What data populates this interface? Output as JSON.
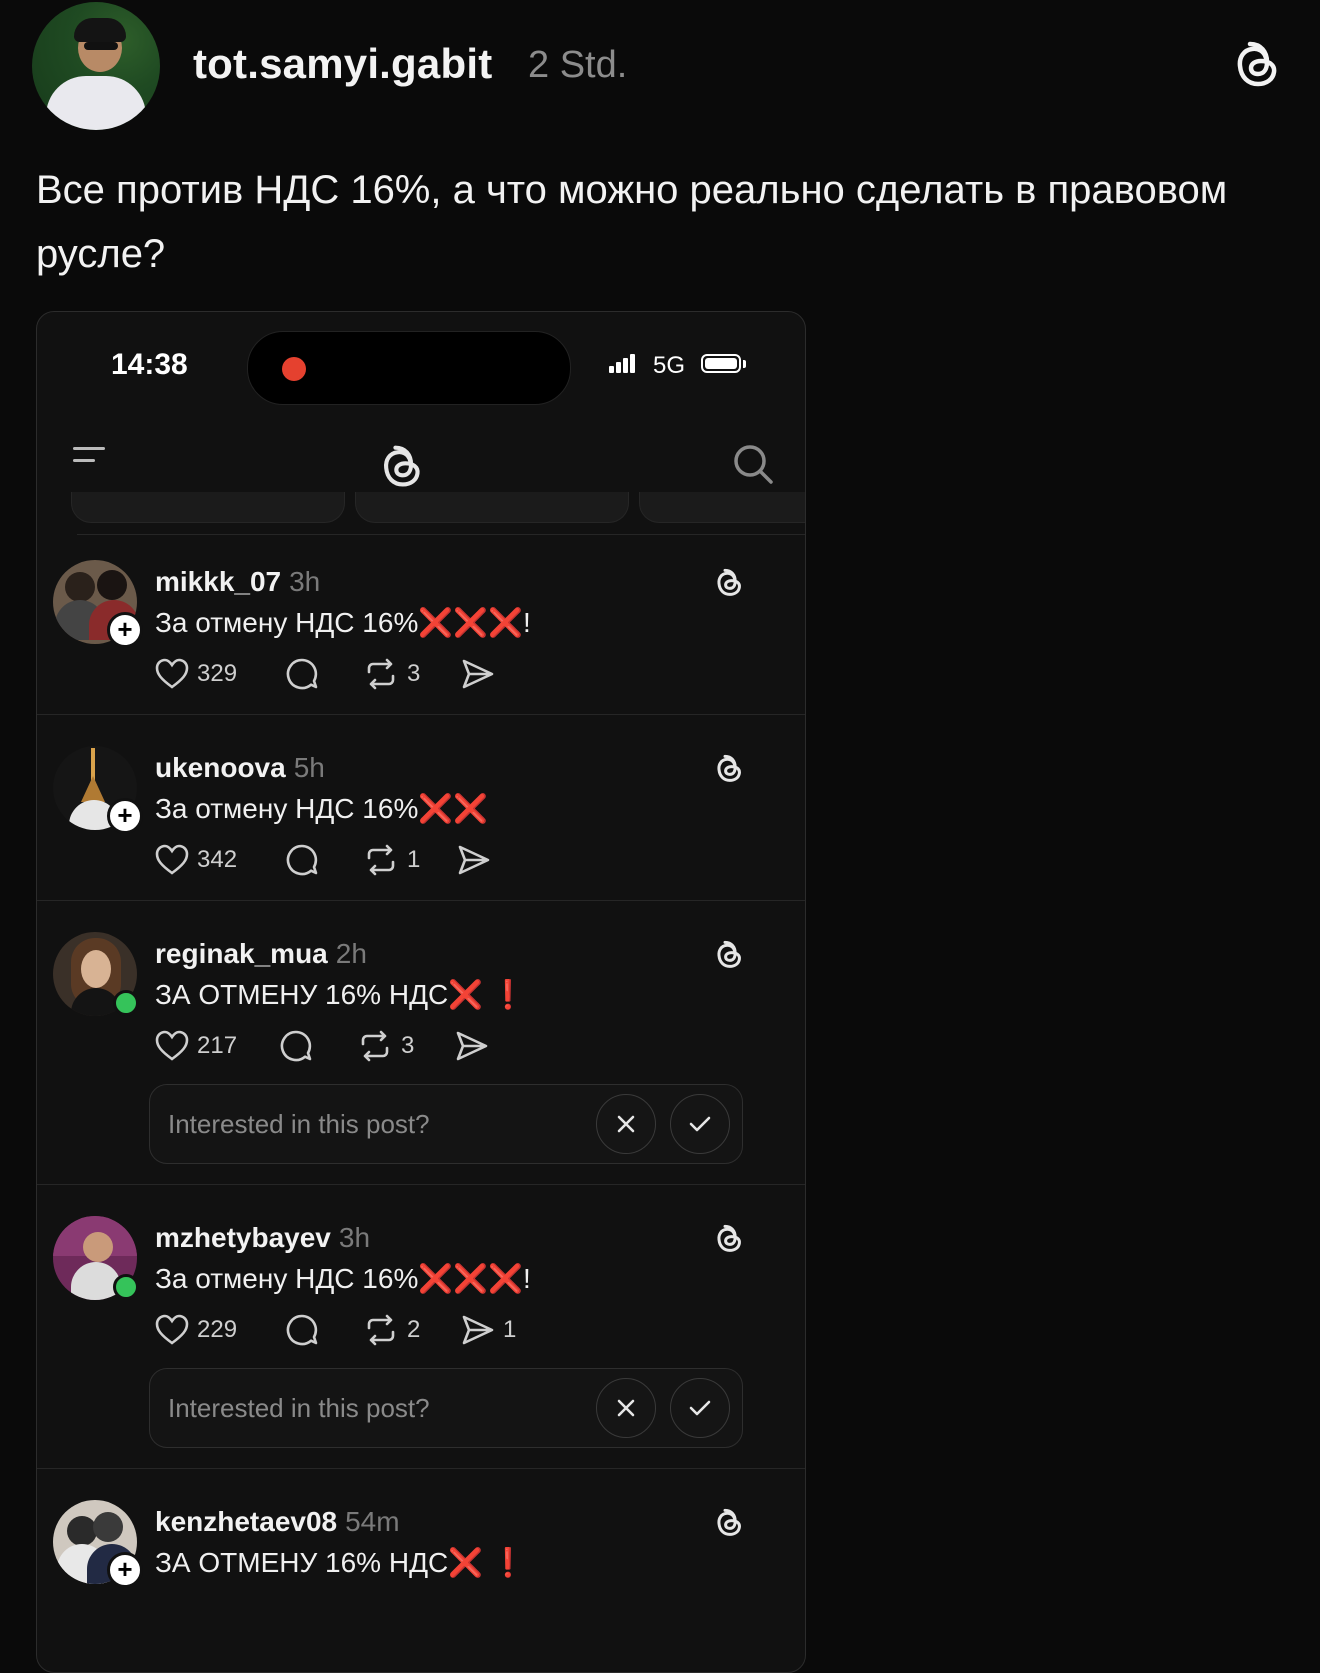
{
  "outer_post": {
    "username": "tot.samyi.gabit",
    "time": "2 Std.",
    "text": "Все против НДС 16%, а что можно реально сделать в правовом русле?",
    "logo_icon": "threads-icon"
  },
  "phone": {
    "status_time": "14:38",
    "network": "5G",
    "posts": [
      {
        "username": "mikkk_07",
        "time": "3h",
        "text": "За отмену НДС 16%",
        "emoji": "❌❌❌",
        "suffix": "!",
        "likes": "329",
        "reposts": "3",
        "shares": "",
        "badge": "plus"
      },
      {
        "username": "ukenoova",
        "time": "5h",
        "text": "За отмену НДС 16%",
        "emoji": "❌❌",
        "suffix": "",
        "likes": "342",
        "reposts": "1",
        "shares": "",
        "badge": "plus"
      },
      {
        "username": "reginak_mua",
        "time": "2h",
        "text": "ЗА ОТМЕНУ 16% НДС",
        "emoji": "❌",
        "suffix": " ❗",
        "likes": "217",
        "reposts": "3",
        "shares": "",
        "badge": "online"
      },
      {
        "username": "mzhetybayev",
        "time": "3h",
        "text": "За отмену НДС 16%",
        "emoji": "❌❌❌",
        "suffix": "!",
        "likes": "229",
        "reposts": "2",
        "shares": "1",
        "badge": "online"
      },
      {
        "username": "kenzhetaev08",
        "time": "54m",
        "text": "ЗА ОТМЕНУ 16% НДС",
        "emoji": "❌",
        "suffix": " ❗",
        "likes": "",
        "reposts": "",
        "shares": "",
        "badge": "plus"
      }
    ],
    "interest_prompt": "Interested in this post?"
  },
  "colors": {
    "background": "#0a0a0a",
    "card": "#111111",
    "accent_red": "#e8263a",
    "online_green": "#35c35a"
  }
}
